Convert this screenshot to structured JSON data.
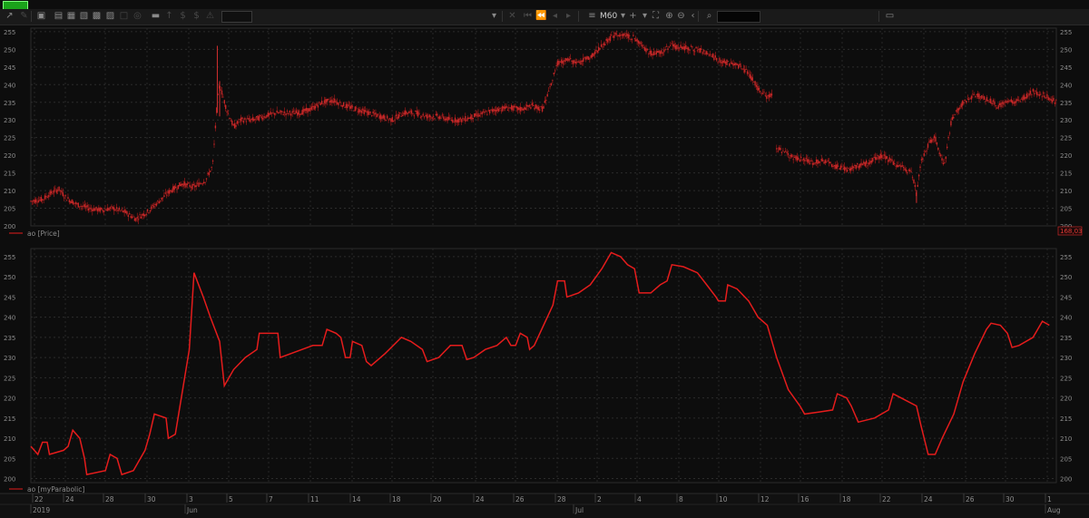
{
  "toolbar": {
    "timeframe": "M60",
    "icons": [
      "crosshair-icon",
      "pencil-icon",
      "new-chart-icon",
      "open-icon",
      "template-icon",
      "save-icon",
      "print-icon",
      "settings-icon",
      "chat-icon",
      "alert-icon",
      "order-icon",
      "position-icon",
      "account-icon",
      "timeframe-box",
      "dropdown-icon",
      "close-icon",
      "first-icon",
      "prev-page-icon",
      "prev-icon",
      "next-icon",
      "last-icon",
      "chart-type-icon",
      "crosshair-plus-icon",
      "fit-icon",
      "zoom-in-icon",
      "zoom-out-icon",
      "scroll-icon",
      "search-icon",
      "notes-icon"
    ]
  },
  "chart_data": [
    {
      "type": "candlestick",
      "legend": "ao [Price]",
      "ylim": [
        200,
        256
      ],
      "yticks": [
        200,
        205,
        210,
        215,
        220,
        225,
        230,
        235,
        240,
        245,
        250,
        255
      ],
      "last_value_label": "168,03",
      "colors": {
        "up": "#c62828",
        "down": "#c62828",
        "wick": "#b71c1c"
      },
      "segments": [
        {
          "from": 0,
          "to": 195,
          "points": [
            [
              0,
              207
            ],
            [
              5,
              207.5
            ],
            [
              8,
              209
            ],
            [
              12,
              210.5
            ],
            [
              15,
              208
            ],
            [
              20,
              206
            ],
            [
              25,
              205
            ],
            [
              30,
              204.5
            ],
            [
              35,
              205
            ],
            [
              40,
              204
            ],
            [
              45,
              202
            ],
            [
              50,
              204
            ],
            [
              55,
              207
            ],
            [
              60,
              210
            ],
            [
              65,
              212
            ],
            [
              70,
              211
            ],
            [
              75,
              213
            ],
            [
              78,
              217
            ],
            [
              80,
              235
            ],
            [
              81,
              240
            ],
            [
              84,
              233
            ],
            [
              87,
              228
            ],
            [
              90,
              230
            ],
            [
              95,
              230
            ],
            [
              100,
              231
            ],
            [
              105,
              232
            ],
            [
              110,
              232
            ],
            [
              115,
              232
            ],
            [
              120,
              233
            ],
            [
              125,
              235
            ],
            [
              130,
              235.5
            ],
            [
              135,
              234
            ],
            [
              140,
              233
            ],
            [
              145,
              232
            ],
            [
              150,
              231
            ],
            [
              155,
              230
            ],
            [
              160,
              232
            ],
            [
              165,
              232
            ],
            [
              170,
              231
            ],
            [
              175,
              231
            ],
            [
              180,
              230
            ],
            [
              185,
              230
            ],
            [
              190,
              231
            ],
            [
              195,
              232
            ],
            [
              200,
              233
            ],
            [
              205,
              233.5
            ],
            [
              210,
              233
            ],
            [
              215,
              234
            ],
            [
              220,
              233
            ]
          ]
        },
        {
          "from": 220,
          "to": 304,
          "points": [
            [
              220,
              234
            ],
            [
              223,
              240
            ],
            [
              226,
              246
            ],
            [
              230,
              247
            ],
            [
              235,
              246
            ],
            [
              240,
              248
            ],
            [
              245,
              251
            ],
            [
              250,
              254
            ],
            [
              255,
              254
            ],
            [
              260,
              253
            ],
            [
              265,
              249
            ],
            [
              270,
              249
            ],
            [
              275,
              251
            ],
            [
              280,
              250.5
            ],
            [
              285,
              250
            ],
            [
              290,
              249
            ],
            [
              295,
              247
            ],
            [
              300,
              246
            ],
            [
              305,
              245
            ],
            [
              308,
              243
            ],
            [
              312,
              239
            ],
            [
              316,
              236.5
            ],
            [
              318,
              237
            ]
          ]
        },
        {
          "from": 320,
          "to": 420,
          "points": [
            [
              320,
              222
            ],
            [
              325,
              220
            ],
            [
              330,
              219
            ],
            [
              335,
              218
            ],
            [
              340,
              218.5
            ],
            [
              345,
              217
            ],
            [
              350,
              216
            ],
            [
              355,
              217
            ],
            [
              360,
              218
            ],
            [
              365,
              220
            ],
            [
              370,
              218
            ],
            [
              375,
              216
            ],
            [
              378,
              215
            ],
            [
              380,
              209
            ],
            [
              382,
              218
            ],
            [
              385,
              223
            ],
            [
              388,
              225
            ],
            [
              390,
              220
            ],
            [
              392,
              217
            ],
            [
              395,
              230
            ],
            [
              400,
              235
            ],
            [
              405,
              237
            ],
            [
              410,
              236
            ],
            [
              415,
              234
            ],
            [
              420,
              235
            ],
            [
              425,
              236
            ],
            [
              430,
              238
            ],
            [
              435,
              237
            ],
            [
              440,
              235
            ]
          ]
        }
      ]
    },
    {
      "type": "line",
      "legend": "ao [myParabolic]",
      "ylim": [
        199,
        257
      ],
      "yticks": [
        200,
        205,
        210,
        215,
        220,
        225,
        230,
        235,
        240,
        245,
        250,
        255
      ],
      "color": "#e51c1c",
      "points": [
        [
          0,
          208
        ],
        [
          3,
          206
        ],
        [
          5,
          209
        ],
        [
          7,
          209
        ],
        [
          8,
          206
        ],
        [
          14,
          207
        ],
        [
          16,
          208
        ],
        [
          18,
          212
        ],
        [
          21,
          210
        ],
        [
          23,
          205
        ],
        [
          24,
          201
        ],
        [
          32,
          202
        ],
        [
          34,
          206
        ],
        [
          37,
          205
        ],
        [
          39,
          201
        ],
        [
          44,
          202
        ],
        [
          49,
          207
        ],
        [
          51,
          211
        ],
        [
          53,
          216
        ],
        [
          58,
          215
        ],
        [
          59,
          210
        ],
        [
          62,
          211
        ],
        [
          68,
          232
        ],
        [
          70,
          251
        ],
        [
          74,
          245
        ],
        [
          77,
          240
        ],
        [
          81,
          234
        ],
        [
          83,
          223
        ],
        [
          87,
          227
        ],
        [
          92,
          230
        ],
        [
          97,
          232
        ],
        [
          98,
          236
        ],
        [
          106,
          236
        ],
        [
          107,
          230
        ],
        [
          121,
          233
        ],
        [
          125,
          233
        ],
        [
          127,
          237
        ],
        [
          131,
          236
        ],
        [
          133,
          235
        ],
        [
          135,
          230
        ],
        [
          137,
          230
        ],
        [
          138,
          234
        ],
        [
          142,
          233
        ],
        [
          144,
          229
        ],
        [
          146,
          228
        ],
        [
          152,
          231
        ],
        [
          159,
          235
        ],
        [
          163,
          234
        ],
        [
          168,
          232
        ],
        [
          170,
          229
        ],
        [
          175,
          230
        ],
        [
          180,
          233
        ],
        [
          185,
          233
        ],
        [
          187,
          229.5
        ],
        [
          190,
          230
        ],
        [
          195,
          232
        ],
        [
          200,
          233
        ],
        [
          204,
          235
        ],
        [
          206,
          233
        ],
        [
          208,
          233
        ],
        [
          210,
          236
        ],
        [
          213,
          235
        ],
        [
          214,
          232
        ],
        [
          216,
          233
        ],
        [
          220,
          238
        ],
        [
          224,
          243
        ],
        [
          226,
          249
        ],
        [
          229,
          249
        ],
        [
          230,
          245
        ],
        [
          235,
          246
        ],
        [
          240,
          248
        ],
        [
          245,
          252
        ],
        [
          249,
          256
        ],
        [
          253,
          255
        ],
        [
          256,
          253
        ],
        [
          259,
          252
        ],
        [
          261,
          246
        ],
        [
          266,
          246
        ],
        [
          270,
          248
        ],
        [
          273,
          249
        ],
        [
          275,
          253
        ],
        [
          280,
          252.5
        ],
        [
          286,
          251
        ],
        [
          290,
          248
        ],
        [
          294,
          245
        ],
        [
          295,
          244
        ],
        [
          298,
          244
        ],
        [
          299,
          248
        ],
        [
          303,
          247
        ],
        [
          308,
          244
        ],
        [
          312,
          240
        ],
        [
          316,
          238
        ],
        [
          320,
          230
        ],
        [
          325,
          222
        ],
        [
          330,
          218
        ],
        [
          332,
          216
        ],
        [
          338,
          216.5
        ],
        [
          344,
          217
        ],
        [
          346,
          221
        ],
        [
          350,
          220
        ],
        [
          352,
          218
        ],
        [
          355,
          214
        ],
        [
          362,
          215
        ],
        [
          368,
          217
        ],
        [
          370,
          221
        ],
        [
          375,
          219.5
        ],
        [
          380,
          218
        ],
        [
          382,
          213
        ],
        [
          385,
          206
        ],
        [
          388,
          206
        ],
        [
          391,
          210
        ],
        [
          396,
          216
        ],
        [
          400,
          224
        ],
        [
          405,
          231
        ],
        [
          410,
          237
        ],
        [
          412,
          238.5
        ],
        [
          416,
          238
        ],
        [
          419,
          236
        ],
        [
          421,
          232.5
        ],
        [
          424,
          233
        ],
        [
          430,
          235
        ],
        [
          432,
          237
        ],
        [
          434,
          239
        ],
        [
          437,
          238
        ]
      ]
    }
  ],
  "x_axis": {
    "days": [
      "22",
      "24",
      "28",
      "30",
      "3",
      "5",
      "7",
      "11",
      "14",
      "18",
      "20",
      "24",
      "26",
      "28",
      "2",
      "4",
      "8",
      "10",
      "12",
      "16",
      "18",
      "22",
      "24",
      "26",
      "30",
      "1"
    ],
    "months": [
      "2019",
      "Jun",
      "Jul",
      "Aug"
    ]
  }
}
